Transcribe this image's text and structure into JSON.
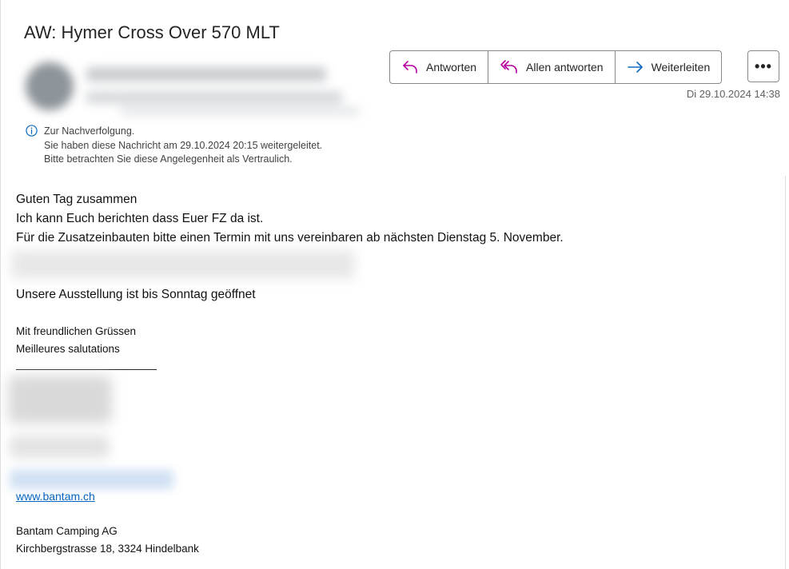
{
  "subject": "AW: Hymer Cross Over 570 MLT",
  "actions": {
    "reply": "Antworten",
    "reply_all": "Allen antworten",
    "forward": "Weiterleiten",
    "more": "•••"
  },
  "date": "Di 29.10.2024 14:38",
  "info": {
    "line1": "Zur Nachverfolgung.",
    "line2": "Sie haben diese Nachricht am 29.10.2024 20:15 weitergeleitet.",
    "line3": "Bitte betrachten Sie diese Angelegenheit als Vertraulich."
  },
  "body": {
    "greeting": "Guten Tag zusammen",
    "line1": "Ich kann Euch berichten dass Euer FZ da ist.",
    "line2": "Für die Zusatzeinbauten bitte einen Termin mit uns vereinbaren ab nächsten Dienstag 5. November.",
    "line3": "Unsere Ausstellung ist bis Sonntag geöffnet"
  },
  "regards": {
    "de": "Mit freundlichen Grüssen",
    "fr": "Meilleures salutations"
  },
  "signature": {
    "website": "www.bantam.ch",
    "company": "Bantam Camping AG",
    "address": "Kirchbergstrasse 18, 3324 Hindelbank"
  },
  "colors": {
    "accent_icon": "#b4009e",
    "forward_icon": "#0f6cbd",
    "link": "#0563c1",
    "info_icon": "#0f6cbd"
  }
}
